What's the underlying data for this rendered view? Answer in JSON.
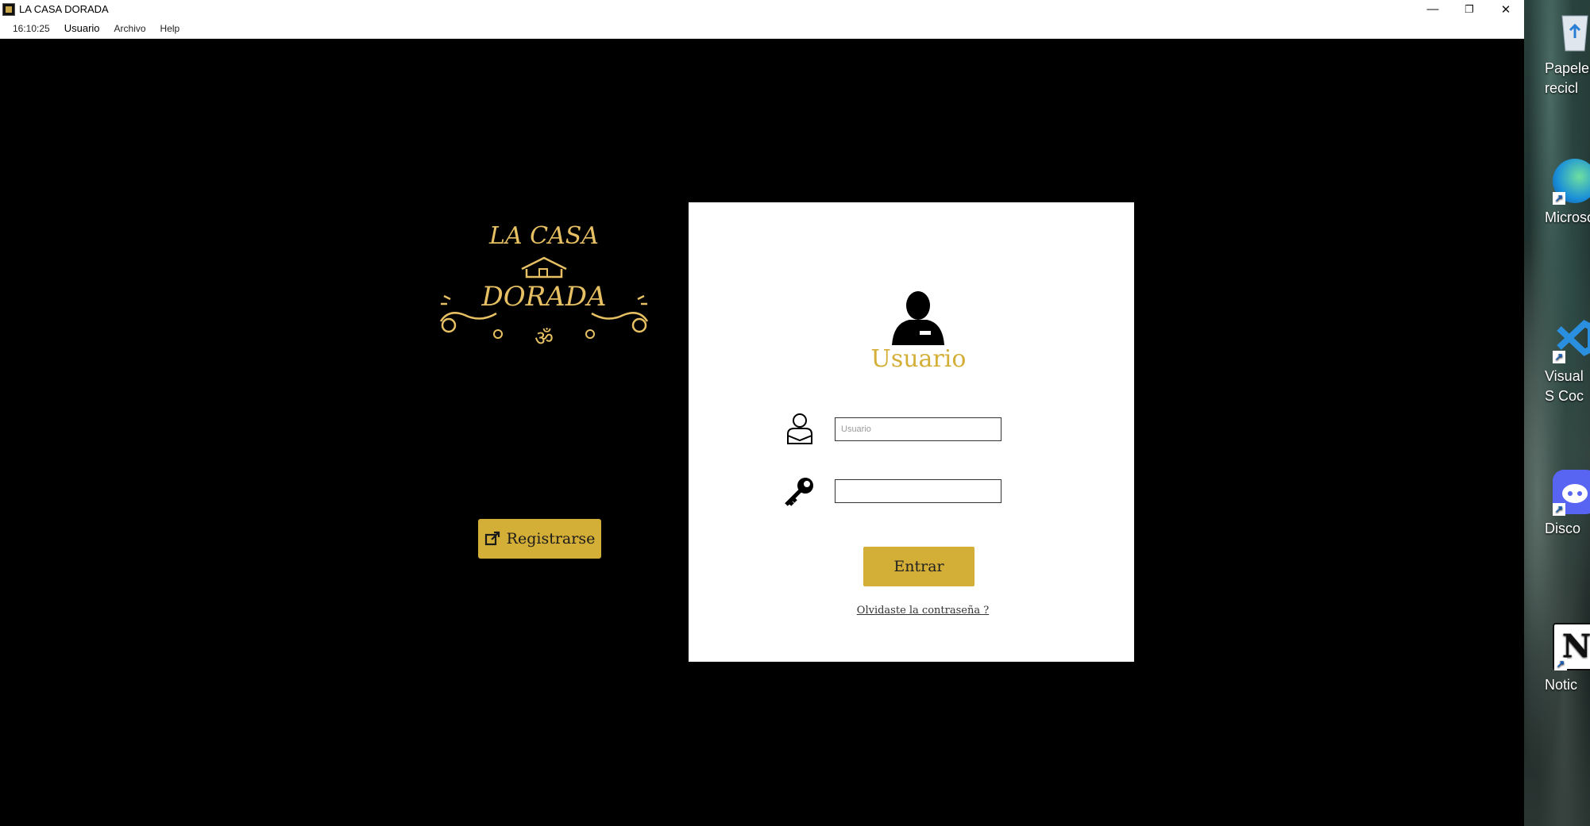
{
  "window": {
    "title": "LA CASA DORADA",
    "controls": {
      "minimize": "—",
      "restore": "❐",
      "close": "✕"
    }
  },
  "menubar": {
    "clock": "16:10:25",
    "items": [
      "Usuario",
      "Archivo",
      "Help"
    ]
  },
  "logo": {
    "line1": "LA CASA",
    "line2": "DORADA",
    "symbol": "ॐ"
  },
  "register_button": {
    "label": "Registrarse",
    "icon": "external-link-icon"
  },
  "login": {
    "title": "Usuario",
    "username_placeholder": "Usuario",
    "password_value": "",
    "enter_label": "Entrar",
    "forgot_link": "Olvidaste la contraseña ?"
  },
  "desktop": {
    "icons": [
      {
        "label": "Papeler recicl",
        "icon": "recycle-bin-icon"
      },
      {
        "label": "Microsof",
        "icon": "edge-icon"
      },
      {
        "label": "Visual S Coc",
        "icon": "vscode-icon"
      },
      {
        "label": "Disco",
        "icon": "discord-icon"
      },
      {
        "label": "Notic",
        "icon": "notion-icon"
      }
    ]
  },
  "colors": {
    "accent": "#d4af37",
    "background": "#000000",
    "panel": "#ffffff"
  }
}
